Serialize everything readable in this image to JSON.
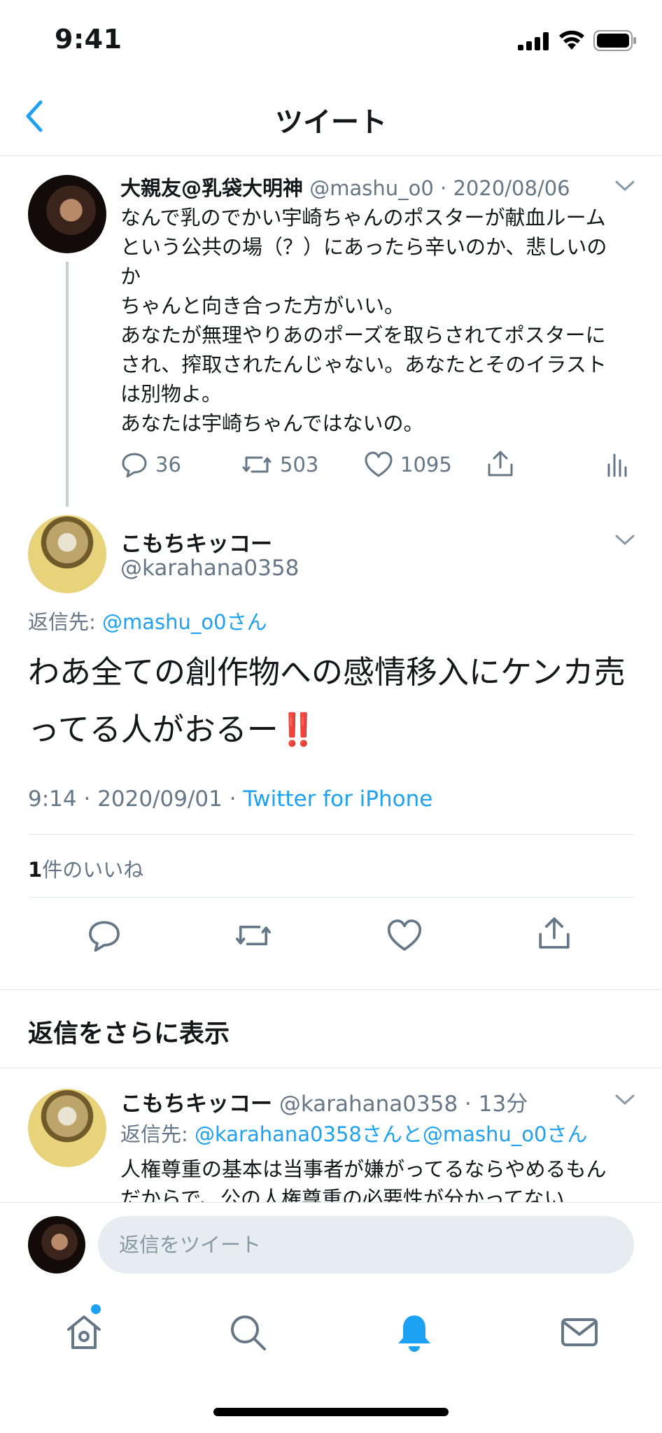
{
  "status_bar": {
    "time": "9:41"
  },
  "nav": {
    "title": "ツイート"
  },
  "parent_tweet": {
    "name": "大親友@乳袋大明神",
    "handle": "@mashu_o0",
    "date": "2020/08/06",
    "text": "なんで乳のでかい宇崎ちゃんのポスターが献血ルームという公共の場（？）にあったら辛いのか、悲しいのか\nちゃんと向き合った方がいい。\nあなたが無理やりあのポーズを取らされてポスターにされ、搾取されたんじゃない。あなたとそのイラストは別物よ。\nあなたは宇崎ちゃんではないの。",
    "replies": "36",
    "retweets": "503",
    "likes": "1095"
  },
  "main_tweet": {
    "name": "こもちキッコー",
    "handle": "@karahana0358",
    "reply_prefix": "返信先: ",
    "reply_to": "@mashu_o0さん",
    "text": "わあ全ての創作物への感情移入にケンカ売ってる人がおるー‼️",
    "time": "9:14",
    "date": "2020/09/01",
    "client": "Twitter for iPhone",
    "likes_count": "1",
    "likes_label": "件のいいね"
  },
  "more_replies": {
    "label": "返信をさらに表示"
  },
  "reply_tweet": {
    "name": "こもちキッコー",
    "handle": "@karahana0358",
    "time_ago": "13分",
    "reply_prefix": "返信先: ",
    "reply_to": "@karahana0358さんと@mashu_o0さん",
    "text": "人権尊重の基本は当事者が嫌がってるならやめるもんだからで、公の人権尊重の必要性が分かってない"
  },
  "compose": {
    "placeholder": "返信をツイート"
  },
  "tabs": [
    "home-icon",
    "search-icon",
    "notifications-icon",
    "messages-icon"
  ],
  "colors": {
    "accent": "#1da1f2",
    "text": "#14171a",
    "muted": "#657786",
    "divider": "#e1e8ed",
    "input_bg": "#e6ecf0"
  }
}
